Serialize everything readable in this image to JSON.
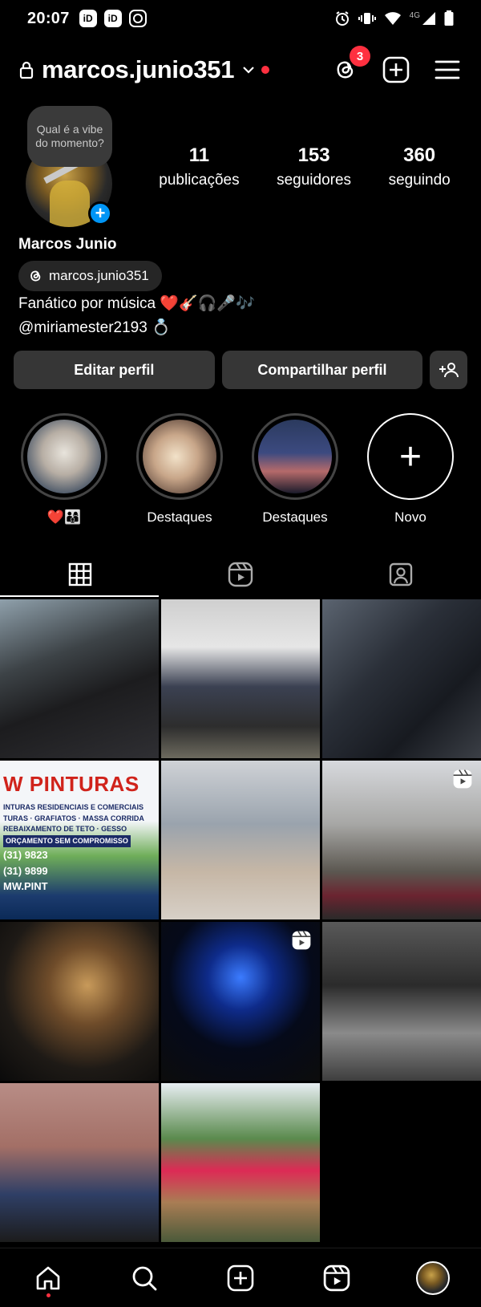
{
  "status_bar": {
    "time": "20:07",
    "apps": [
      "iD",
      "iD"
    ],
    "network": "4G"
  },
  "header": {
    "username": "marcos.junio351",
    "threads_badge": "3"
  },
  "profile": {
    "note": "Qual é a vibe do momento?",
    "full_name": "Marcos Junio",
    "threads_handle": "marcos.junio351",
    "bio_line1": "Fanático por música ❤️🎸🎧🎤🎶",
    "bio_line2": "@miriamester2193 💍",
    "stats": [
      {
        "value": "11",
        "label": "publicações"
      },
      {
        "value": "153",
        "label": "seguidores"
      },
      {
        "value": "360",
        "label": "seguindo"
      }
    ]
  },
  "actions": {
    "edit": "Editar perfil",
    "share": "Compartilhar perfil"
  },
  "highlights": [
    {
      "label": "❤️👨‍👩‍👦"
    },
    {
      "label": "Destaques"
    },
    {
      "label": "Destaques"
    },
    {
      "label": "Novo"
    }
  ],
  "new_highlight_symbol": "+",
  "grid_posts": [
    {
      "type": "photo",
      "icon": ""
    },
    {
      "type": "photo",
      "icon": ""
    },
    {
      "type": "photo",
      "icon": ""
    },
    {
      "type": "photo",
      "text": "W PINTURAS",
      "subtext": [
        "INTURAS RESIDENCIAIS E COMERCIAIS",
        "TURAS · GRAFIATOS · MASSA CORRIDA",
        "REBAIXAMENTO DE TETO · GESSO",
        "ORÇAMENTO SEM COMPROMISSO",
        "(31) 9823",
        "(31) 9899",
        "MW.PINT"
      ]
    },
    {
      "type": "photo",
      "icon": ""
    },
    {
      "type": "reel",
      "icon": "reel-icon"
    },
    {
      "type": "photo",
      "icon": ""
    },
    {
      "type": "reel",
      "icon": "reel-icon"
    },
    {
      "type": "photo",
      "icon": ""
    },
    {
      "type": "photo",
      "icon": ""
    },
    {
      "type": "photo",
      "icon": ""
    }
  ],
  "colors": {
    "background": "#000000",
    "button": "#363636",
    "accent_blue": "#0095f6",
    "notification_red": "#ff3040"
  }
}
